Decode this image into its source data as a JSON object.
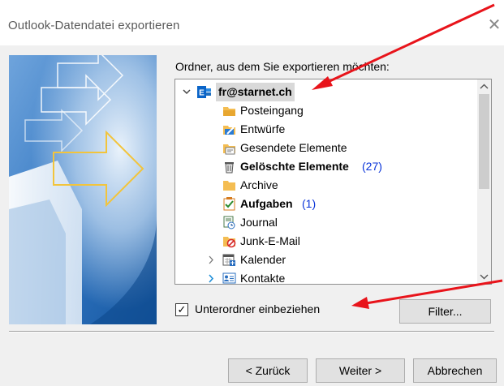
{
  "window": {
    "title": "Outlook-Datendatei exportieren",
    "close_glyph": "✕"
  },
  "prompt": "Ordner, aus dem Sie exportieren möchten:",
  "tree": {
    "account": {
      "label": "fr@starnet.ch",
      "icon": "exchange-account-icon",
      "expanded": true,
      "selected": true
    },
    "folders": [
      {
        "label": "Posteingang",
        "count": "",
        "bold": false,
        "icon": "inbox-folder-icon"
      },
      {
        "label": "Entwürfe",
        "count": "",
        "bold": false,
        "icon": "drafts-icon"
      },
      {
        "label": "Gesendete Elemente",
        "count": "",
        "bold": false,
        "icon": "sent-items-icon"
      },
      {
        "label": "Gelöschte Elemente",
        "count": "(27)",
        "bold": true,
        "icon": "trash-icon"
      },
      {
        "label": "Archive",
        "count": "",
        "bold": false,
        "icon": "folder-icon"
      },
      {
        "label": "Aufgaben",
        "count": "(1)",
        "bold": true,
        "icon": "tasks-icon"
      },
      {
        "label": "Journal",
        "count": "",
        "bold": false,
        "icon": "journal-icon"
      },
      {
        "label": "Junk-E-Mail",
        "count": "",
        "bold": false,
        "icon": "junk-mail-icon"
      },
      {
        "label": "Kalender",
        "count": "",
        "bold": false,
        "icon": "calendar-icon"
      },
      {
        "label": "Kontakte",
        "count": "",
        "bold": false,
        "icon": "contacts-icon"
      }
    ]
  },
  "include_subfolders": {
    "label": "Unterordner einbeziehen",
    "checked": true,
    "check_glyph": "✓"
  },
  "buttons": {
    "filter": "Filter...",
    "back": "< Zurück",
    "next": "Weiter >",
    "cancel": "Abbrechen"
  },
  "colors": {
    "window_bg": "#f0f0f0",
    "count_blue": "#0a34d9",
    "selection": "#d9d9d9",
    "annotation_red": "#e8141b",
    "exchange_blue": "#0a64c8"
  }
}
